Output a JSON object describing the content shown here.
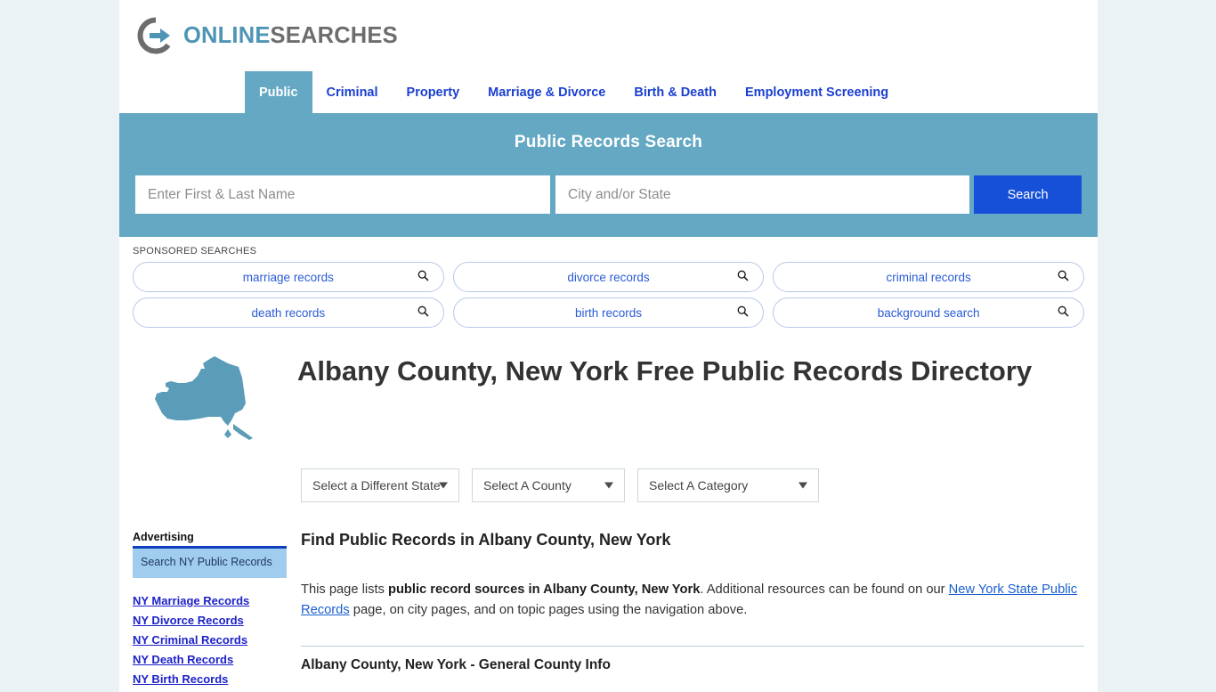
{
  "brand": {
    "name_part1": "ONLINE",
    "name_part2": "SEARCHES",
    "icon": "circle-arrow-logo"
  },
  "nav": {
    "items": [
      {
        "label": "Public",
        "active": true
      },
      {
        "label": "Criminal",
        "active": false
      },
      {
        "label": "Property",
        "active": false
      },
      {
        "label": "Marriage & Divorce",
        "active": false
      },
      {
        "label": "Birth & Death",
        "active": false
      },
      {
        "label": "Employment Screening",
        "active": false
      }
    ]
  },
  "search": {
    "title": "Public Records Search",
    "name_placeholder": "Enter First & Last Name",
    "name_value": "",
    "city_placeholder": "City and/or State",
    "city_value": "",
    "button_label": "Search",
    "band_color": "#64a8c4",
    "button_color": "#1750d8"
  },
  "sponsored": {
    "label": "SPONSORED SEARCHES",
    "items": [
      {
        "label": "marriage records",
        "icon": "search-icon"
      },
      {
        "label": "divorce records",
        "icon": "search-icon"
      },
      {
        "label": "criminal records",
        "icon": "search-icon"
      },
      {
        "label": "death records",
        "icon": "search-icon"
      },
      {
        "label": "birth records",
        "icon": "search-icon"
      },
      {
        "label": "background search",
        "icon": "search-icon"
      }
    ]
  },
  "hero": {
    "title": "Albany County, New York Free Public Records Directory",
    "map_icon": "new-york-state-map",
    "map_color": "#5b9cb8"
  },
  "selects": [
    {
      "label": "Select a Different State",
      "icon": "chevron-down-icon"
    },
    {
      "label": "Select A County",
      "icon": "chevron-down-icon"
    },
    {
      "label": "Select A Category",
      "icon": "chevron-down-icon"
    }
  ],
  "sidebar": {
    "advertising_label": "Advertising",
    "ad_text": "Search NY Public Records",
    "links": [
      "NY Marriage Records",
      "NY Divorce Records",
      "NY Criminal Records",
      "NY Death Records",
      "NY Birth Records"
    ]
  },
  "content": {
    "heading": "Find Public Records in Albany County, New York",
    "paragraph": {
      "t1": "This page lists ",
      "b1": "public record sources in Albany County, New York",
      "t2": ". Additional resources can be found on our ",
      "link": "New York State Public Records",
      "t3": " page, on city pages, and on topic pages using the navigation above."
    },
    "subsection_heading": "Albany County, New York - General County Info"
  }
}
